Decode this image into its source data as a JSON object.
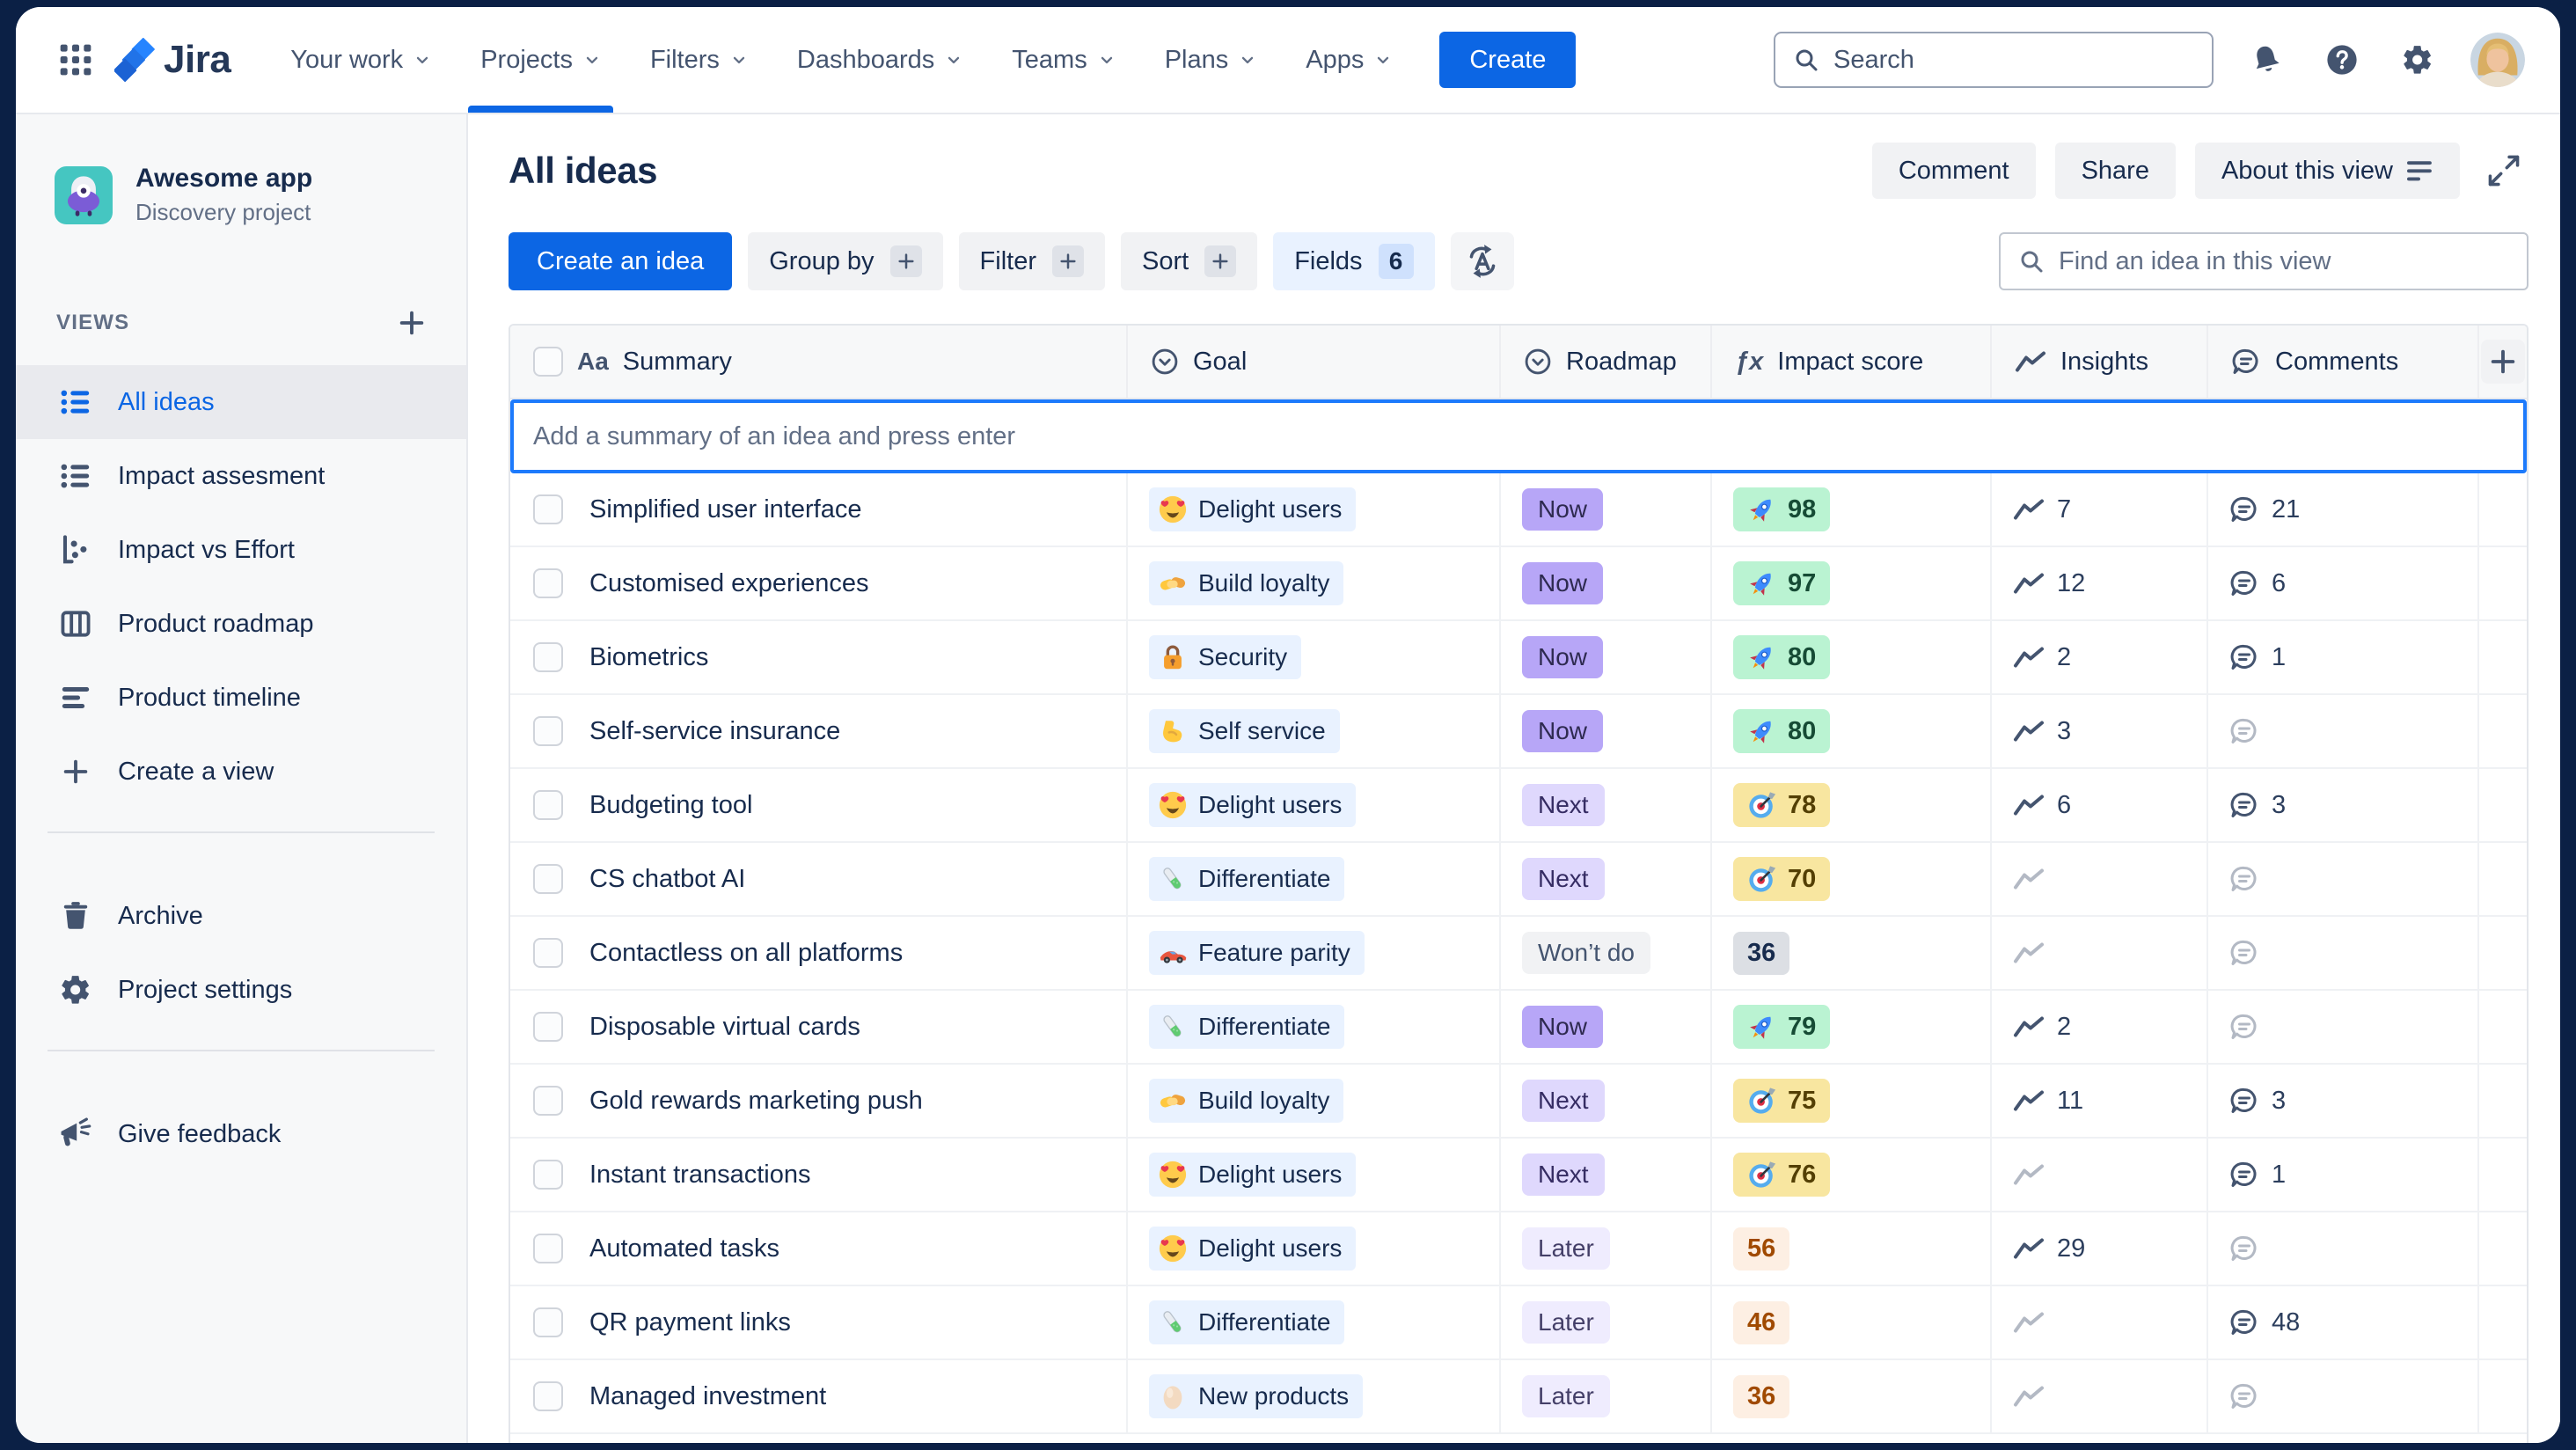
{
  "nav": {
    "logo_text": "Jira",
    "items": [
      {
        "label": "Your work"
      },
      {
        "label": "Projects",
        "active": true
      },
      {
        "label": "Filters"
      },
      {
        "label": "Dashboards"
      },
      {
        "label": "Teams"
      },
      {
        "label": "Plans"
      },
      {
        "label": "Apps"
      }
    ],
    "create_label": "Create",
    "search_placeholder": "Search"
  },
  "sidebar": {
    "project": {
      "name": "Awesome app",
      "type": "Discovery project"
    },
    "views_label": "VIEWS",
    "view_items": [
      {
        "label": "All ideas",
        "icon": "list-view-icon",
        "selected": true
      },
      {
        "label": "Impact assesment",
        "icon": "list-view-icon"
      },
      {
        "label": "Impact vs Effort",
        "icon": "scatter-chart-icon"
      },
      {
        "label": "Product roadmap",
        "icon": "board-icon"
      },
      {
        "label": "Product timeline",
        "icon": "timeline-icon"
      },
      {
        "label": "Create a view",
        "icon": "plus-icon"
      }
    ],
    "tool_items": [
      {
        "label": "Archive",
        "icon": "trash-icon"
      },
      {
        "label": "Project settings",
        "icon": "gear-icon"
      }
    ],
    "footer_items": [
      {
        "label": "Give feedback",
        "icon": "megaphone-icon"
      }
    ]
  },
  "view_header": {
    "title": "All ideas",
    "comment_label": "Comment",
    "share_label": "Share",
    "about_label": "About this view"
  },
  "toolbar": {
    "create_idea_label": "Create an idea",
    "group_by_label": "Group by",
    "filter_label": "Filter",
    "sort_label": "Sort",
    "fields_label": "Fields",
    "fields_count": "6",
    "find_placeholder": "Find an idea in this view"
  },
  "table": {
    "add_placeholder": "Add a summary of an idea and press enter",
    "columns": [
      {
        "label": "Summary",
        "icon": "text-field-icon"
      },
      {
        "label": "Goal",
        "icon": "select-field-icon"
      },
      {
        "label": "Roadmap",
        "icon": "select-field-icon"
      },
      {
        "label": "Impact score",
        "icon": "formula-field-icon"
      },
      {
        "label": "Insights",
        "icon": "trend-icon"
      },
      {
        "label": "Comments",
        "icon": "comment-icon"
      }
    ],
    "rows": [
      {
        "summary": "Simplified user interface",
        "goal": {
          "emoji": "heart-eyes-emoji",
          "label": "Delight users"
        },
        "roadmap": {
          "label": "Now",
          "variant": "now"
        },
        "impact": {
          "value": "98",
          "variant": "green",
          "emoji": "rocket-emoji"
        },
        "insights": "7",
        "comments": "21"
      },
      {
        "summary": "Customised experiences",
        "goal": {
          "emoji": "handshake-emoji",
          "label": "Build loyalty"
        },
        "roadmap": {
          "label": "Now",
          "variant": "now"
        },
        "impact": {
          "value": "97",
          "variant": "green",
          "emoji": "rocket-emoji"
        },
        "insights": "12",
        "comments": "6"
      },
      {
        "summary": "Biometrics",
        "goal": {
          "emoji": "lock-emoji",
          "label": "Security"
        },
        "roadmap": {
          "label": "Now",
          "variant": "now"
        },
        "impact": {
          "value": "80",
          "variant": "green",
          "emoji": "rocket-emoji"
        },
        "insights": "2",
        "comments": "1"
      },
      {
        "summary": "Self-service insurance",
        "goal": {
          "emoji": "bicep-emoji",
          "label": "Self service"
        },
        "roadmap": {
          "label": "Now",
          "variant": "now"
        },
        "impact": {
          "value": "80",
          "variant": "green",
          "emoji": "rocket-emoji"
        },
        "insights": "3",
        "comments": null
      },
      {
        "summary": "Budgeting tool",
        "goal": {
          "emoji": "heart-eyes-emoji",
          "label": "Delight users"
        },
        "roadmap": {
          "label": "Next",
          "variant": "next"
        },
        "impact": {
          "value": "78",
          "variant": "yellow",
          "emoji": "dart-emoji"
        },
        "insights": "6",
        "comments": "3"
      },
      {
        "summary": "CS chatbot AI",
        "goal": {
          "emoji": "test-tube-emoji",
          "label": "Differentiate"
        },
        "roadmap": {
          "label": "Next",
          "variant": "next"
        },
        "impact": {
          "value": "70",
          "variant": "yellow",
          "emoji": "dart-emoji"
        },
        "insights": null,
        "comments": null
      },
      {
        "summary": "Contactless on all platforms",
        "goal": {
          "emoji": "race-car-emoji",
          "label": "Feature parity"
        },
        "roadmap": {
          "label": "Won’t do",
          "variant": "wontdo"
        },
        "impact": {
          "value": "36",
          "variant": "grey",
          "emoji": null
        },
        "insights": null,
        "comments": null
      },
      {
        "summary": "Disposable virtual cards",
        "goal": {
          "emoji": "test-tube-emoji",
          "label": "Differentiate"
        },
        "roadmap": {
          "label": "Now",
          "variant": "now"
        },
        "impact": {
          "value": "79",
          "variant": "green",
          "emoji": "rocket-emoji"
        },
        "insights": "2",
        "comments": null
      },
      {
        "summary": "Gold rewards marketing push",
        "goal": {
          "emoji": "handshake-emoji",
          "label": "Build loyalty"
        },
        "roadmap": {
          "label": "Next",
          "variant": "next"
        },
        "impact": {
          "value": "75",
          "variant": "yellow",
          "emoji": "dart-emoji"
        },
        "insights": "11",
        "comments": "3"
      },
      {
        "summary": "Instant transactions",
        "goal": {
          "emoji": "heart-eyes-emoji",
          "label": "Delight users"
        },
        "roadmap": {
          "label": "Next",
          "variant": "next"
        },
        "impact": {
          "value": "76",
          "variant": "yellow",
          "emoji": "dart-emoji"
        },
        "insights": null,
        "comments": "1"
      },
      {
        "summary": "Automated tasks",
        "goal": {
          "emoji": "heart-eyes-emoji",
          "label": "Delight users"
        },
        "roadmap": {
          "label": "Later",
          "variant": "later"
        },
        "impact": {
          "value": "56",
          "variant": "peach",
          "emoji": null
        },
        "insights": "29",
        "comments": null
      },
      {
        "summary": "QR payment links",
        "goal": {
          "emoji": "test-tube-emoji",
          "label": "Differentiate"
        },
        "roadmap": {
          "label": "Later",
          "variant": "later"
        },
        "impact": {
          "value": "46",
          "variant": "peach",
          "emoji": null
        },
        "insights": null,
        "comments": "48"
      },
      {
        "summary": "Managed investment",
        "goal": {
          "emoji": "egg-emoji",
          "label": "New products"
        },
        "roadmap": {
          "label": "Later",
          "variant": "later"
        },
        "impact": {
          "value": "36",
          "variant": "peach",
          "emoji": null
        },
        "insights": null,
        "comments": null
      }
    ]
  },
  "colors": {
    "brand_blue": "#0C66E4",
    "nav_underline": "#0C66E4",
    "chip_now": "#B7A6F7",
    "chip_next": "#DFD8FD",
    "chip_later": "#EFECFE",
    "chip_wontdo": "#F1F2F4",
    "impact_green": "#BAF3D2",
    "impact_yellow": "#F8E6A0",
    "impact_grey": "#DCDFE4",
    "impact_peach": "#FDEFE3",
    "goal_chip": "#E9F2FF"
  }
}
